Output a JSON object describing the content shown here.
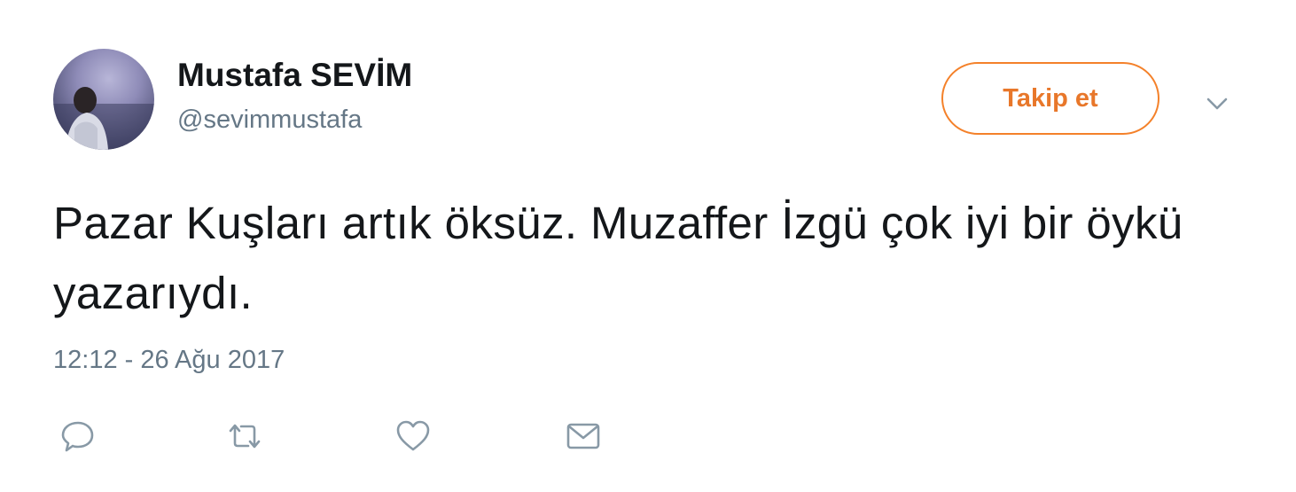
{
  "user": {
    "display_name": "Mustafa SEVİM",
    "handle": "@sevimmustafa",
    "avatar_icon": "profile-photo"
  },
  "header": {
    "follow_label": "Takip et",
    "menu_icon": "chevron-down-icon"
  },
  "tweet": {
    "text": "Pazar Kuşları artık öksüz. Muzaffer İzgü çok iyi bir öykü yazarıydı.",
    "timestamp": "12:12 - 26 Ağu 2017"
  },
  "actions": [
    {
      "name": "reply",
      "icon": "reply-icon"
    },
    {
      "name": "retweet",
      "icon": "retweet-icon"
    },
    {
      "name": "like",
      "icon": "heart-icon"
    },
    {
      "name": "message",
      "icon": "envelope-icon"
    }
  ],
  "colors": {
    "follow_accent": "#f4812a",
    "secondary_text": "#657786",
    "primary_text": "#14171a",
    "icon_gray": "#8899a6"
  }
}
